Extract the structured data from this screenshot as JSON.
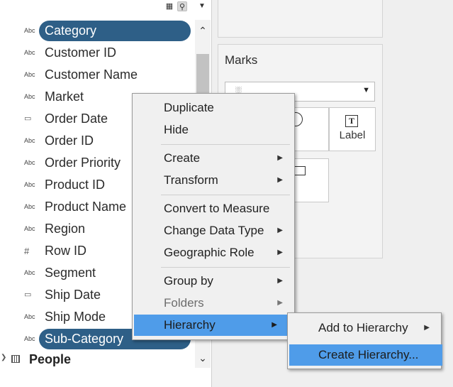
{
  "data_pane": {
    "fields": [
      {
        "type": "Abc",
        "label": "Category",
        "selected": true
      },
      {
        "type": "Abc",
        "label": "Customer ID"
      },
      {
        "type": "Abc",
        "label": "Customer Name"
      },
      {
        "type": "Abc",
        "label": "Market"
      },
      {
        "type": "calendar",
        "label": "Order Date"
      },
      {
        "type": "Abc",
        "label": "Order ID"
      },
      {
        "type": "Abc",
        "label": "Order Priority"
      },
      {
        "type": "Abc",
        "label": "Product ID"
      },
      {
        "type": "Abc",
        "label": "Product Name"
      },
      {
        "type": "Abc",
        "label": "Region"
      },
      {
        "type": "#",
        "label": "Row ID"
      },
      {
        "type": "Abc",
        "label": "Segment"
      },
      {
        "type": "calendar",
        "label": "Ship Date"
      },
      {
        "type": "Abc",
        "label": "Ship Mode"
      },
      {
        "type": "Abc",
        "label": "Sub-Category",
        "selected": true
      }
    ],
    "people_folder": {
      "label": "People",
      "icon": "table-icon"
    },
    "type_glyphs": {
      "abc": "Abc",
      "calendar": "▭",
      "number": "#"
    },
    "toolbar_icons": [
      "list-icon",
      "search-icon",
      "dropdown-icon"
    ]
  },
  "marks_card": {
    "title": "Marks",
    "mark_type_icon": "bar-chart-icon",
    "label_button": "Label",
    "label_glyph": "T"
  },
  "context_menu": {
    "duplicate": "Duplicate",
    "hide": "Hide",
    "create": "Create",
    "transform": "Transform",
    "convert_to_measure": "Convert to Measure",
    "change_data_type": "Change Data Type",
    "geographic_role": "Geographic Role",
    "group_by": "Group by",
    "folders": "Folders",
    "hierarchy": "Hierarchy",
    "submenu_arrow": "▶"
  },
  "submenu": {
    "add_to_hierarchy": "Add to Hierarchy",
    "create_hierarchy": "Create Hierarchy..."
  },
  "colors": {
    "selected_pill": "#2e5f87",
    "menu_highlight": "#4f9ce9"
  }
}
